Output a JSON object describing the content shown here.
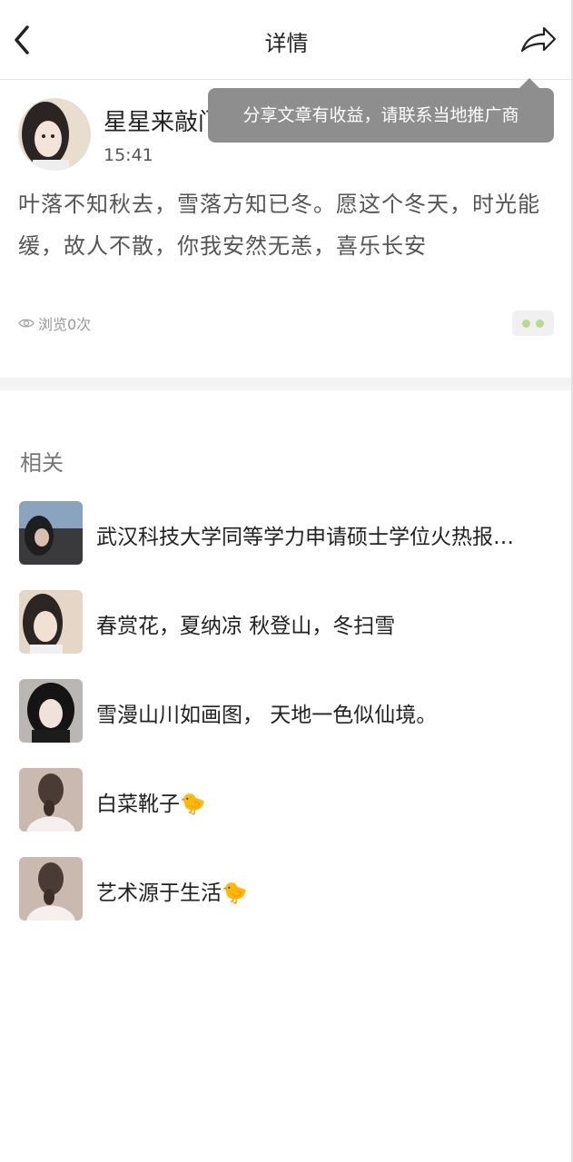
{
  "header": {
    "title": "详情"
  },
  "post": {
    "author": "星星来敲门",
    "time": "15:41",
    "content": "叶落不知秋去，雪落方知已冬。愿这个冬天，时光能缓，故人不散，你我安然无恙，喜乐长安",
    "views": "浏览0次"
  },
  "tooltip": {
    "text": "分享文章有收益，请联系当地推广商"
  },
  "related": {
    "title": "相关",
    "items": [
      {
        "title": "武汉科技大学同等学力申请硕士学位火热报…"
      },
      {
        "title": "春赏花，夏纳凉 秋登山，冬扫雪"
      },
      {
        "title": "雪漫山川如画图， 天地一色似仙境。"
      },
      {
        "title": "白菜靴子🐤"
      },
      {
        "title": "艺术源于生活🐤"
      }
    ]
  },
  "colors": {
    "tooltip_bg": "#8e8e8e",
    "more_dots": "#b5dc8a",
    "divider": "#f4f4f4"
  }
}
